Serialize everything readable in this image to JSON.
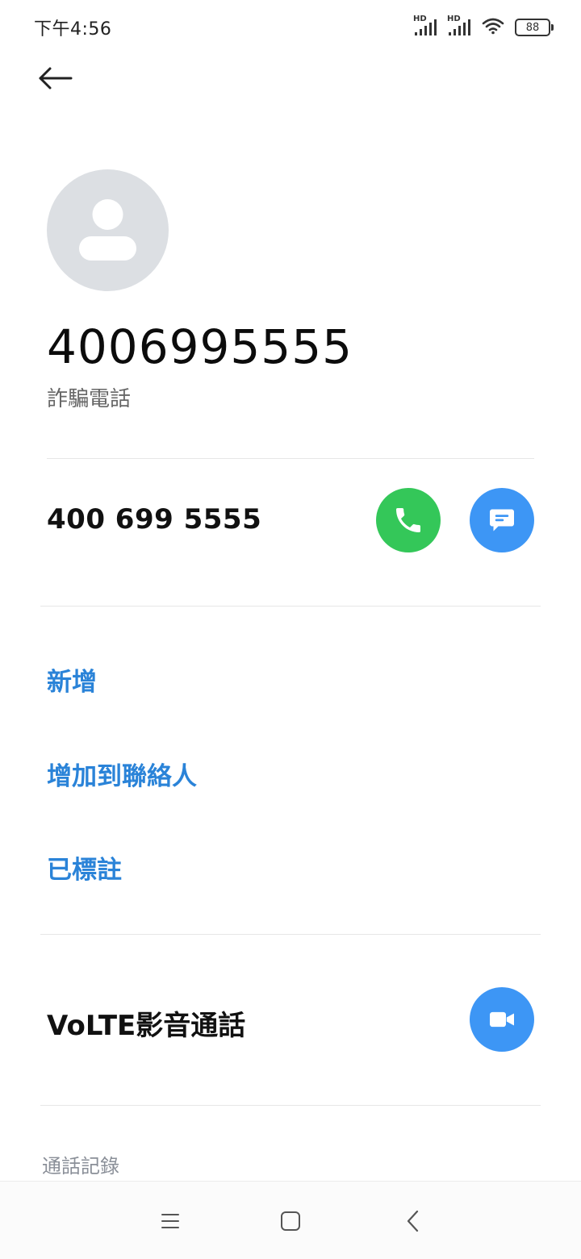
{
  "status_bar": {
    "time": "下午4:56",
    "signal_1_label": "HD",
    "signal_2_label": "HD",
    "battery": "88"
  },
  "contact": {
    "title_number": "4006995555",
    "tag": "詐騙電話"
  },
  "phone_row": {
    "formatted_number": "400 699 5555",
    "call_color": "#34c759",
    "message_color": "#3d96f5"
  },
  "actions": [
    {
      "label": "新增"
    },
    {
      "label": "增加到聯絡人"
    },
    {
      "label": "已標註"
    }
  ],
  "volte": {
    "label": "VoLTE影音通話",
    "button_color": "#3d96f5"
  },
  "history": {
    "label": "通話記錄"
  },
  "colors": {
    "accent_blue": "#2a83d8",
    "avatar_bg": "#dcdfe3"
  },
  "icons": {
    "back": "back-arrow-icon",
    "call": "phone-icon",
    "message": "message-icon",
    "video": "video-camera-icon",
    "nav_menu": "menu-icon",
    "nav_home": "home-icon",
    "nav_back": "back-chevron-icon"
  }
}
